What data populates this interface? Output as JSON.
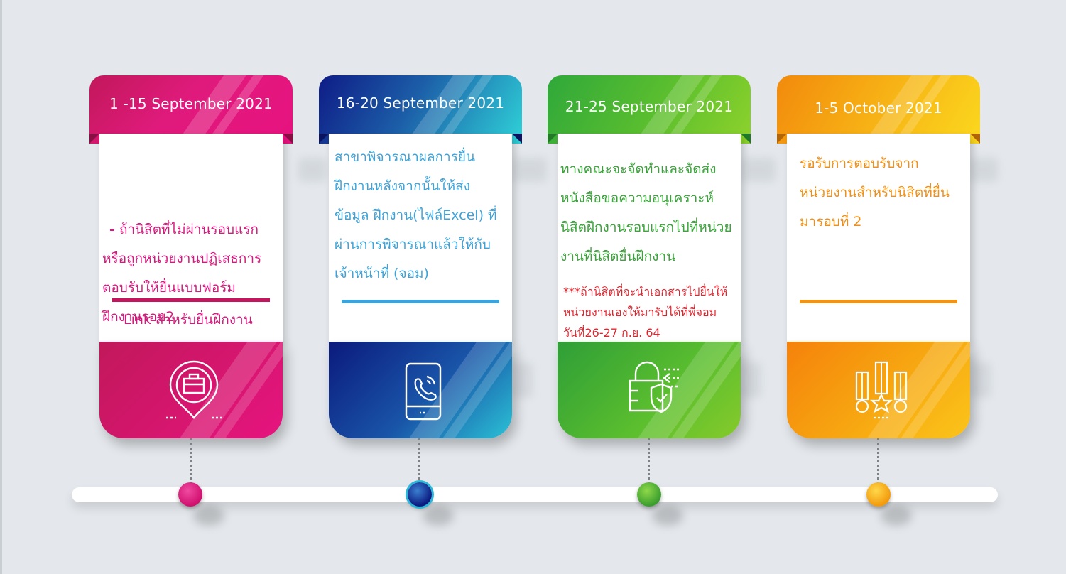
{
  "cards": [
    {
      "date": "1 -15 September 2021",
      "bullet": "-",
      "lines": [
        "ถ้านิสิตที่ไม่ผ่านรอบแรก",
        "หรือถูกหน่วยงานปฏิเสธการ",
        "ตอบรับให้ยื่นแบบฟอร์ม",
        "ฝึกงานรอบ2"
      ],
      "link_label": "Link สำหรับยื่นฝึกงาน",
      "icon": "briefcase-location-icon",
      "color": "#e0147d"
    },
    {
      "date": "16-20 September 2021",
      "lines": [
        "สาขาพิจารณาผลการยื่น",
        "ฝึกงานหลังจากนั้นให้ส่ง",
        "ข้อมูล ฝึกงาน(ไฟล์Excel) ที่",
        "ผ่านการพิจารณาแล้วให้กับ",
        "เจ้าหน้าที่ (จอม)"
      ],
      "icon": "phone-call-icon",
      "color": "#1a3ea0"
    },
    {
      "date": "21-25 September 2021",
      "lines": [
        "ทางคณะจะจัดทำและจัดส่ง",
        "หนังสือขอความอนุเคราะห์",
        "นิสิตฝึกงานรอบแรกไปที่หน่วย",
        "งานที่นิสิตยื่นฝึกงาน"
      ],
      "note_lines": [
        "***ถ้านิสิตที่จะนำเอกสารไปยื่นให้",
        "หน่วยงานเองให้มารับได้ที่พี่จอม",
        "วันที่26-27 ก.ย. 64"
      ],
      "icon": "lock-shield-icon",
      "color": "#5cbf2e"
    },
    {
      "date": "1-5 October 2021",
      "lines": [
        "รอรับการตอบรับจาก",
        "หน่วยงานสำหรับนิสิตที่ยื่น",
        "มารอบที่ 2"
      ],
      "icon": "medals-icon",
      "color": "#f7a811"
    }
  ],
  "colors": {
    "pink": "#e0147d",
    "blue": "#1a3ea0",
    "green": "#5cbf2e",
    "orange": "#f7a811",
    "background": "#e4e8ec"
  }
}
